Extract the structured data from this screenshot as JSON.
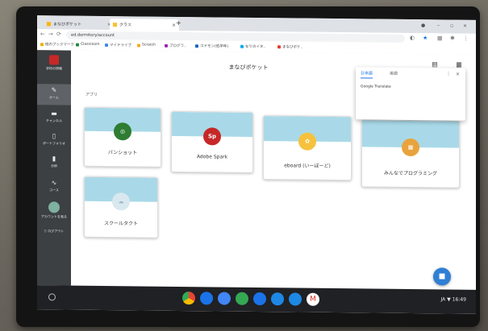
{
  "browser": {
    "tabs": [
      {
        "label": "まなびポケット",
        "active": false
      },
      {
        "label": "クラス",
        "active": true
      }
    ],
    "url": "ed.dormitory/account"
  },
  "bookmarks": [
    {
      "label": "他のブックマーク",
      "color": "#e8b100"
    },
    {
      "label": "Classroom",
      "color": "#1e8e3e"
    },
    {
      "label": "マイドライブ",
      "color": "#4285f4"
    },
    {
      "label": "Scratch",
      "color": "#f9a825"
    },
    {
      "label": "ブログラ..",
      "color": "#9c27b0"
    },
    {
      "label": "コドモン(低学年)",
      "color": "#1565c0"
    },
    {
      "label": "なりのイタ..",
      "color": "#03a9f4"
    },
    {
      "label": "まなびポケ..",
      "color": "#e53935"
    }
  ],
  "sidebar": {
    "items": [
      {
        "label": "学校の情報",
        "icon": "school-icon"
      },
      {
        "label": "ホーム",
        "icon": "pencil-icon"
      },
      {
        "label": "チャンネル",
        "icon": "chat-icon"
      },
      {
        "label": "ポートフォリオ",
        "icon": "document-icon"
      },
      {
        "label": "分析",
        "icon": "chart-icon"
      },
      {
        "label": "コース",
        "icon": "route-icon"
      },
      {
        "label": "アカウントを見る",
        "icon": "avatar"
      },
      {
        "label": "ログアウト",
        "icon": "logout-icon"
      }
    ]
  },
  "main": {
    "title": "まなびポケット",
    "section_label": "アプリ",
    "toolbar": [
      {
        "label": "ストア",
        "icon": "store-icon"
      },
      {
        "label": "学習履歴",
        "icon": "history-icon"
      }
    ],
    "apps": [
      {
        "label": "パンショット",
        "logo_color": "#2e7d32",
        "logo_text": "◎"
      },
      {
        "label": "Adobe Spark",
        "logo_color": "#c62828",
        "logo_text": "Sp"
      },
      {
        "label": "eboard (いーぼーど)",
        "logo_color": "#f6c23e",
        "logo_text": "✿"
      },
      {
        "label": "みんなでプログラミング",
        "logo_color": "#e8a33d",
        "logo_text": "▦"
      },
      {
        "label": "スクールタクト",
        "logo_color": "#d8e8ee",
        "logo_text": "☁"
      }
    ]
  },
  "translate_popup": {
    "tab1": "日本語",
    "tab2": "英語",
    "text": "Google Translate"
  },
  "shelf": {
    "apps": [
      {
        "name": "chrome-icon",
        "color": "#e8453c"
      },
      {
        "name": "files-icon",
        "color": "#1a73e8"
      },
      {
        "name": "docs-icon",
        "color": "#4285f4"
      },
      {
        "name": "drive-icon",
        "color": "#34a853"
      },
      {
        "name": "meet-icon",
        "color": "#1a73e8"
      },
      {
        "name": "classroom-icon",
        "color": "#1e88e5"
      },
      {
        "name": "camera-icon",
        "color": "#1e88e5"
      },
      {
        "name": "gmail-icon",
        "color": "#ffffff"
      }
    ],
    "status": "JA ▼ 16:49"
  }
}
